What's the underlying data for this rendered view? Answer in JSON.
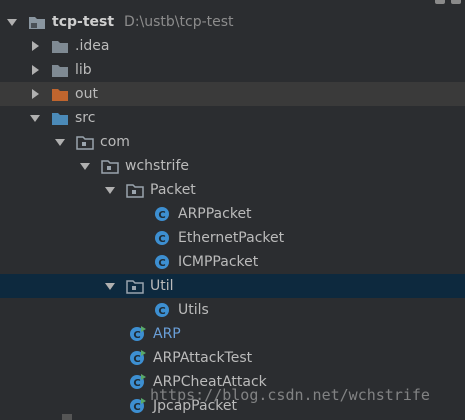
{
  "project": {
    "name": "tcp-test",
    "path": "D:\\ustb\\tcp-test"
  },
  "folders": {
    "idea": ".idea",
    "lib": "lib",
    "out": "out",
    "src": "src",
    "com": "com",
    "wchstrife": "wchstrife",
    "packet": "Packet",
    "util": "Util"
  },
  "files": {
    "arp_packet": "ARPPacket",
    "ethernet_packet": "EthernetPacket",
    "icmp_packet": "ICMPPacket",
    "utils": "Utils",
    "arp": "ARP",
    "arp_attack_test": "ARPAttackTest",
    "arp_cheat_attack": "ARPCheatAttack",
    "jpcap_packet": "JpcapPacket"
  },
  "watermark": "https://blog.csdn.net/wchstrife",
  "colors": {
    "background": "#2b2d30",
    "selected_row": "#0d293e",
    "class_icon": "#3d8fd1",
    "folder_gray": "#7f8a93",
    "folder_orange": "#c0652e",
    "folder_src": "#4b8ab8",
    "runnable_badge": "#59a869"
  }
}
